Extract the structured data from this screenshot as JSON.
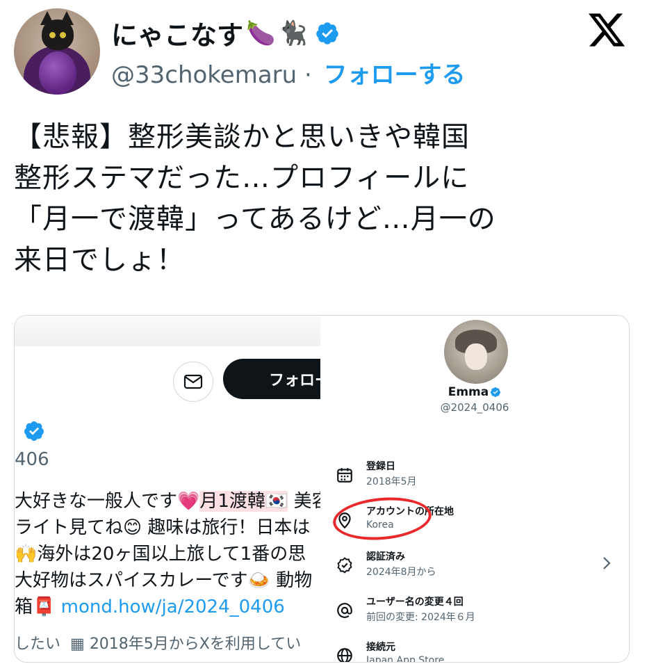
{
  "header": {
    "display_name": "にゃこなす",
    "name_emojis": [
      "🍆",
      "🐈‍⬛"
    ],
    "handle": "@33chokemaru",
    "separator": "·",
    "follow_label": "フォローする"
  },
  "tweet": {
    "text": "【悲報】整形美談かと思いきや韓国\n整形ステマだった…プロフィールに\n「月一で渡韓」ってあるけど…月一の\n来日でしょ！"
  },
  "left_profile": {
    "follow_button_label": "フォロー",
    "handle_fragment": "406",
    "bio_line1_a": "大好きな一般人です",
    "bio_line1_emoji": "💗",
    "bio_line1_highlight": "月1渡韓🇰🇷",
    "bio_line1_b": " 美容",
    "bio_line2_a": "ライト見てね",
    "bio_line2_emoji": "😊",
    "bio_line2_b": " 趣味は旅行！日本は",
    "bio_line3_emoji": "🙌",
    "bio_line3_b": "海外は20ヶ国以上旅して1番の思",
    "bio_line4_a": "大好物はスパイスカレーです",
    "bio_line4_emoji": "🍛",
    "bio_line4_b": " 動物",
    "bio_line5_a": "箱",
    "bio_line5_emoji": "📮",
    "bio_link": "mond.how/ja/2024_0406",
    "meta_a": "したい",
    "meta_joined": "2018年5月からXを利用してい"
  },
  "about_panel": {
    "name": "Emma",
    "handle": "@2024_0406",
    "items": [
      {
        "label": "登録日",
        "value": "2018年5月",
        "icon": "calendar-icon"
      },
      {
        "label": "アカウントの所在地",
        "value": "Korea",
        "icon": "location-pin-icon"
      },
      {
        "label": "認証済み",
        "value": "2024年8月から",
        "icon": "verified-check-icon"
      },
      {
        "label": "ユーザー名の変更４回",
        "value": "前回の変更: 2024年６月",
        "icon": "at-icon"
      },
      {
        "label": "接続元",
        "value": "Japan App Store",
        "icon": "globe-icon"
      }
    ]
  },
  "colors": {
    "accent": "#1d9bf0",
    "text": "#0f1419",
    "muted": "#536471",
    "annotation_red": "#e8282b"
  }
}
